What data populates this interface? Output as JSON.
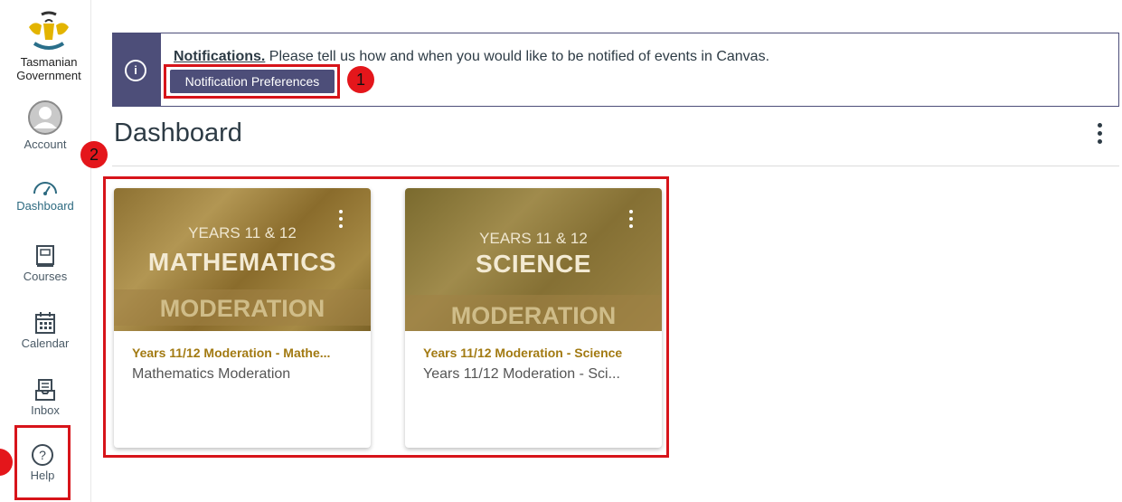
{
  "logo": {
    "line1": "Tasmanian",
    "line2": "Government"
  },
  "nav": {
    "account": "Account",
    "dashboard": "Dashboard",
    "courses": "Courses",
    "calendar": "Calendar",
    "inbox": "Inbox",
    "help": "Help"
  },
  "notification": {
    "title": "Notifications.",
    "message": "Please tell us how and when you would like to be notified of events in Canvas.",
    "button": "Notification Preferences"
  },
  "page": {
    "title": "Dashboard"
  },
  "cards": [
    {
      "hero_years": "YEARS 11 & 12",
      "hero_subject": "MATHEMATICS",
      "hero_mod": "MODERATION",
      "title": "Years 11/12 Moderation - Mathe...",
      "subtitle": "Mathematics Moderation"
    },
    {
      "hero_years": "YEARS 11 & 12",
      "hero_subject": "SCIENCE",
      "hero_mod": "MODERATION",
      "title": "Years 11/12 Moderation - Science",
      "subtitle": "Years 11/12 Moderation - Sci..."
    }
  ],
  "annotations": {
    "n1": "1",
    "n2": "2"
  },
  "colors": {
    "brand": "#4d4e79",
    "annotation": "#d7141a",
    "course_title": "#a27a12"
  }
}
